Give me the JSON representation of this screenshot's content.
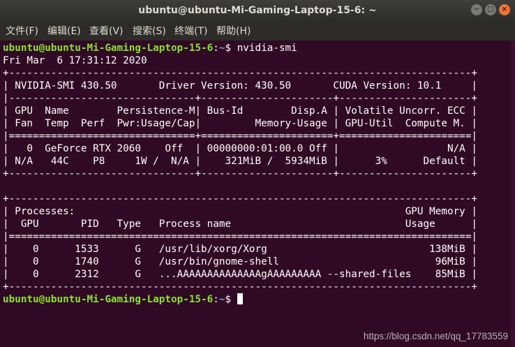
{
  "window": {
    "title": "ubuntu@ubuntu-Mi-Gaming-Laptop-15-6: ~",
    "buttons": {
      "minimize": "−",
      "maximize": "□",
      "close": "×"
    }
  },
  "menu": [
    "文件(F)",
    "编辑(E)",
    "查看(V)",
    "搜索(S)",
    "终端(T)",
    "帮助(H)"
  ],
  "prompt": {
    "user_host": "ubuntu@ubuntu-Mi-Gaming-Laptop-15-6",
    "sep": ":",
    "path": "~",
    "symbol": "$"
  },
  "command": " nvidia-smi",
  "output": [
    "Fri Mar  6 17:31:12 2020",
    "+-----------------------------------------------------------------------------+",
    "| NVIDIA-SMI 430.50       Driver Version: 430.50       CUDA Version: 10.1     |",
    "|-------------------------------+----------------------+----------------------+",
    "| GPU  Name        Persistence-M| Bus-Id        Disp.A | Volatile Uncorr. ECC |",
    "| Fan  Temp  Perf  Pwr:Usage/Cap|         Memory-Usage | GPU-Util  Compute M. |",
    "|===============================+======================+======================|",
    "|   0  GeForce RTX 2060    Off  | 00000000:01:00.0 Off |                  N/A |",
    "| N/A   44C    P8     1W /  N/A |    321MiB /  5934MiB |      3%      Default |",
    "+-------------------------------+----------------------+----------------------+",
    "",
    "+-----------------------------------------------------------------------------+",
    "| Processes:                                                       GPU Memory |",
    "|  GPU       PID   Type   Process name                             Usage      |",
    "|=============================================================================|",
    "|    0      1533      G   /usr/lib/xorg/Xorg                           138MiB |",
    "|    0      1740      G   /usr/bin/gnome-shell                          96MiB |",
    "|    0      2312      G   ...AAAAAAAAAAAAAAgAAAAAAAAA --shared-files    85MiB |",
    "+-----------------------------------------------------------------------------+"
  ],
  "watermark": "https://blog.csdn.net/qq_17783559",
  "colors": {
    "background": "#300a24",
    "prompt_user": "#8ae234",
    "prompt_path": "#729fcf",
    "text": "#ffffff"
  }
}
